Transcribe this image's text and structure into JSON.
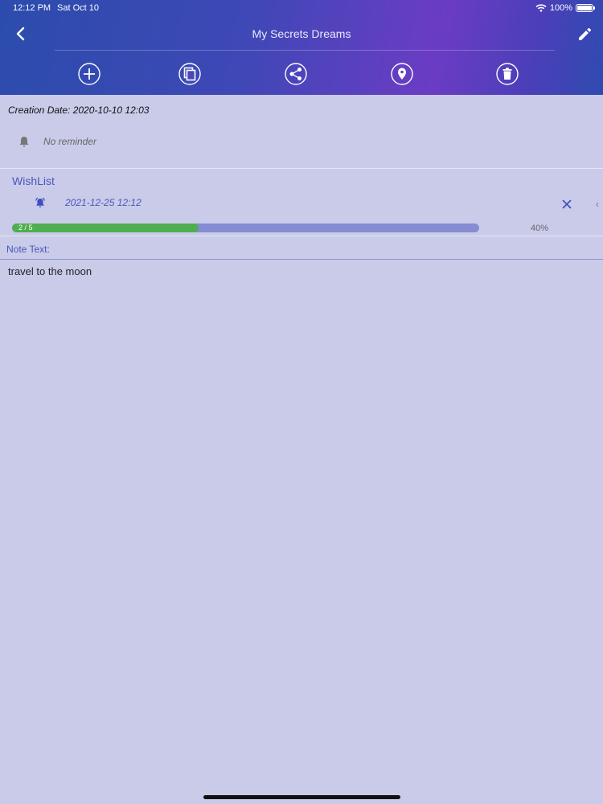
{
  "status_bar": {
    "time": "12:12 PM",
    "date": "Sat Oct 10",
    "battery": "100%"
  },
  "header": {
    "title": "My Secrets Dreams",
    "back_icon": "chevron-left-icon",
    "edit_icon": "pencil-icon",
    "toolbar_icons": [
      "add-circle-icon",
      "duplicate-icon",
      "share-icon",
      "location-pin-icon",
      "trash-icon"
    ]
  },
  "note": {
    "creation_date": "Creation Date: 2020-10-10 12:03",
    "reminder": "No reminder",
    "note_label": "Note Text:",
    "note_text": "travel to the moon"
  },
  "wishlist": {
    "label": "WishList",
    "alarm_date": "2021-12-25 12:12",
    "chevron": "‹",
    "progress": {
      "text": "2 / 5",
      "percent_label": "40%",
      "fraction": 0.4
    }
  },
  "colors": {
    "header_gradient_start": "#2c4cad",
    "header_gradient_mid": "#6b3cc4",
    "background": "#c9cbe9",
    "accent": "#4a57b7",
    "progress_fill": "#4fae4f",
    "progress_track": "#858cd4"
  }
}
